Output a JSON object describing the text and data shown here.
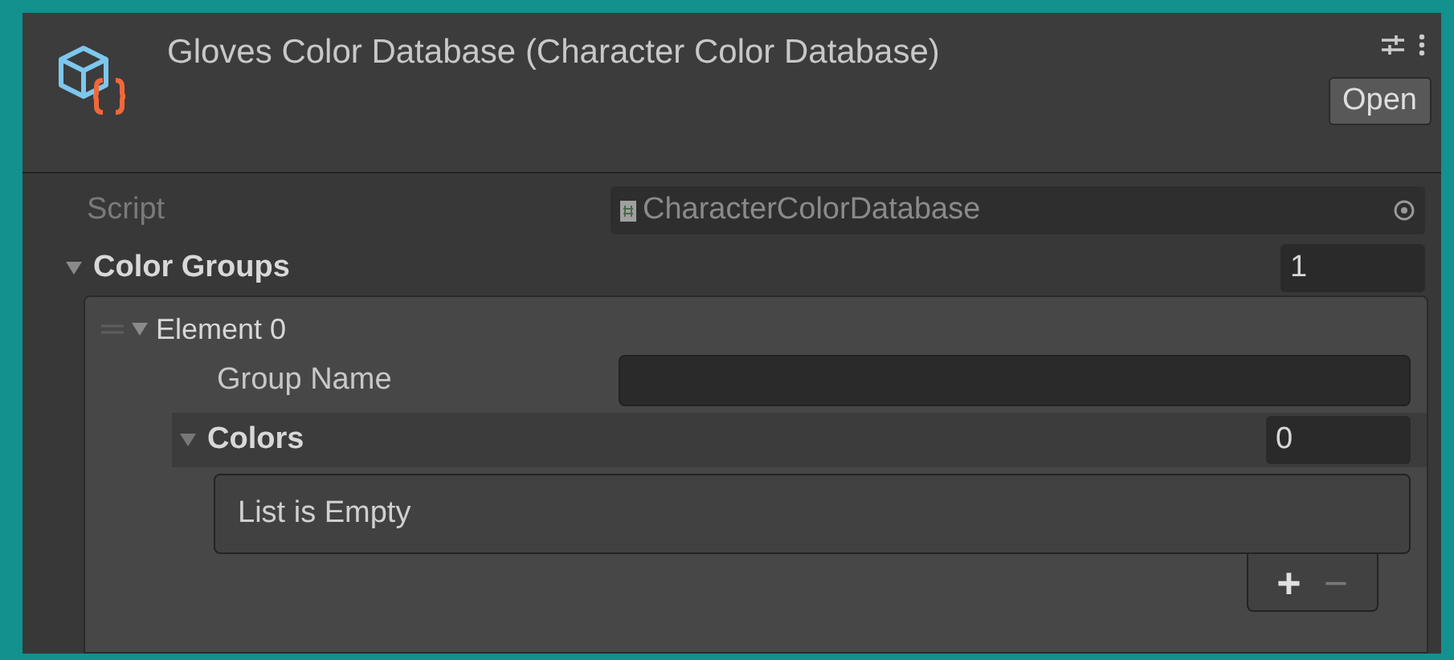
{
  "header": {
    "title": "Gloves Color Database (Character Color Database)",
    "open_button": "Open"
  },
  "script_field": {
    "label": "Script",
    "value": "CharacterColorDatabase"
  },
  "color_groups": {
    "label": "Color Groups",
    "expanded": true,
    "size": "1",
    "elements": [
      {
        "label": "Element 0",
        "expanded": true,
        "group_name": {
          "label": "Group Name"
        },
        "colors": {
          "label": "Colors",
          "expanded": true,
          "size": "0",
          "empty_text": "List is Empty",
          "add": "+",
          "remove": "−",
          "remove_disabled": true
        }
      }
    ]
  }
}
